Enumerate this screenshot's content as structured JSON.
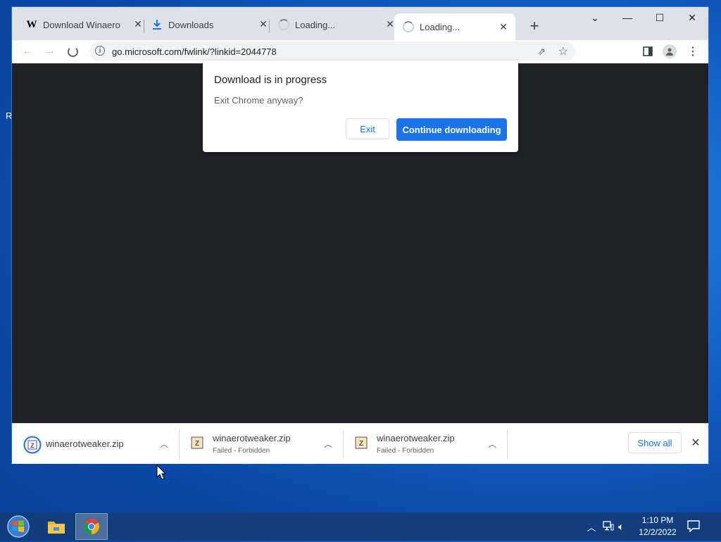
{
  "tabs": [
    {
      "title": "Download Winaero T",
      "favicon": "winaero-w-icon"
    },
    {
      "title": "Downloads",
      "favicon": "download-arrow-icon"
    },
    {
      "title": "Loading...",
      "favicon": "spinner-icon"
    },
    {
      "title": "Loading...",
      "favicon": "spinner-icon",
      "active": true
    }
  ],
  "toolbar": {
    "url": "go.microsoft.com/fwlink/?linkid=2044778"
  },
  "dialog": {
    "title": "Download is in progress",
    "message": "Exit Chrome anyway?",
    "exit_label": "Exit",
    "continue_label": "Continue downloading"
  },
  "downloads": [
    {
      "name": "winaerotweaker.zip",
      "status": ""
    },
    {
      "name": "winaerotweaker.zip",
      "status": "Failed - Forbidden"
    },
    {
      "name": "winaerotweaker.zip",
      "status": "Failed - Forbidden"
    }
  ],
  "shelf": {
    "show_all_label": "Show all"
  },
  "taskbar": {
    "time": "1:10 PM",
    "date": "12/2/2022"
  },
  "colors": {
    "accent": "#1a73e8",
    "content_bg": "#202124",
    "desktop": "#1565c8"
  }
}
